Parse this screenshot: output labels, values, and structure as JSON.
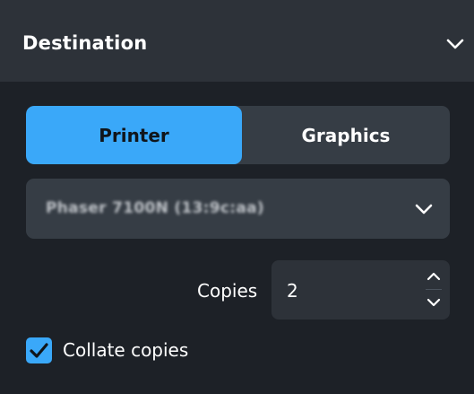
{
  "header": {
    "title": "Destination",
    "collapse_icon": "chevron-down-icon"
  },
  "destination_tabs": [
    {
      "label": "Printer",
      "selected": true
    },
    {
      "label": "Graphics",
      "selected": false
    }
  ],
  "printer_select": {
    "value": "Phaser 7100N (13:9c:aa)",
    "icon": "chevron-down-icon"
  },
  "copies": {
    "label": "Copies",
    "value": "2",
    "increment_icon": "chevron-up-icon",
    "decrement_icon": "chevron-down-icon"
  },
  "collate": {
    "label": "Collate copies",
    "checked": true
  },
  "colors": {
    "background": "#1d2127",
    "header_background": "#2d3239",
    "control_background": "#363d45",
    "accent": "#3aa8f9"
  }
}
